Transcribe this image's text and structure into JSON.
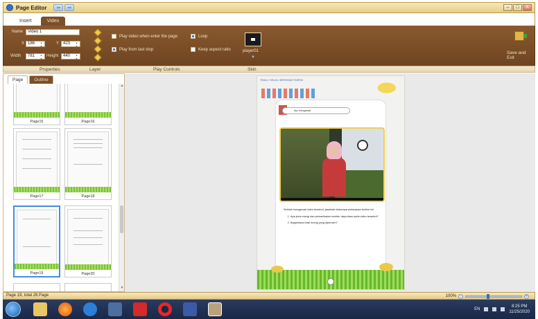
{
  "app": {
    "title": "Page Editor",
    "quick_back": "⇦",
    "quick_forward": "⇨",
    "window_controls": [
      "–",
      "□",
      "X"
    ]
  },
  "ribbon_tabs": [
    "Insert",
    "Video"
  ],
  "properties": {
    "name_label": "Name",
    "name_value": "Video 1",
    "x_label": "X",
    "x_value": "186",
    "y_label": "Y",
    "y_value": "423",
    "width_label": "Width",
    "width_value": "781",
    "height_label": "Height",
    "height_value": "440"
  },
  "play_controls": {
    "play_on_enter": "Play video when enter the page",
    "play_last_stop": "Play from last stop",
    "loop": "Loop",
    "keep_aspect": "Keep aspect ratio"
  },
  "skin": {
    "label": "player01"
  },
  "save": {
    "label": "Save and Exit"
  },
  "group_labels": [
    "Properties",
    "Layer",
    "Play Controls",
    "Skin"
  ],
  "left_panel": {
    "tabs": [
      "Page",
      "Outline"
    ],
    "thumbnails": [
      "Page15",
      "Page16",
      "Page17",
      "Page18",
      "Page19",
      "Page20"
    ]
  },
  "book": {
    "header": "TEMA 2: SELALU BERHEMAT ENERGI",
    "banner": "Ayo mengamati",
    "question_intro": "Setelah mengamati video tersebut, jawablah beberapa pertanyaan berikut ini!",
    "questions": [
      "Apa jenis energi dan pemanfaatan sumber daya alam pada video tersebut?",
      "Bagaimana hasil energi yang diperoleh?"
    ]
  },
  "status": {
    "text": "Page 19, total 28 Page",
    "zoom": "100%"
  },
  "tray": {
    "lang": "EN",
    "time": "8:25 PM",
    "date": "11/25/2020"
  }
}
